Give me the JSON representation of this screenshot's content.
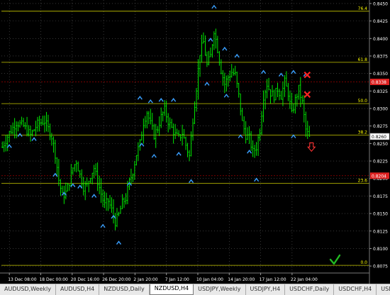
{
  "window": {
    "symbol": "NZDUSD",
    "timeframe": "H4"
  },
  "colors": {
    "background": "#000000",
    "candle": "#00ff00",
    "grid": "#5a5a5a",
    "fib_level": "#c8c800",
    "fib_label": "#ffff00",
    "resistance_line": "#a00000",
    "label_red_bg": "#dd2222",
    "fractal_arrow": "#3aa0ff",
    "signal_cross": "#ff2222",
    "signal_down_arrow": "#ff3333",
    "check_mark": "#22bb22",
    "axis_text": "#ffffff"
  },
  "icons": {
    "fractal": "chevron-up-icon",
    "signal": "cross-icon",
    "down": "down-arrow-icon",
    "check": "check-mark-icon"
  },
  "tabs": [
    {
      "label": "AUDUSD,Weekly",
      "active": false
    },
    {
      "label": "AUDUSD,H4",
      "active": false
    },
    {
      "label": "NZDUSD,Daily",
      "active": false
    },
    {
      "label": "NZDUSD,H4",
      "active": true
    },
    {
      "label": "USDJPY,Weekly",
      "active": false
    },
    {
      "label": "USDJPY,H4",
      "active": false
    },
    {
      "label": "USDCHF,Daily",
      "active": false
    },
    {
      "label": "USDCHF,H4",
      "active": false
    },
    {
      "label": "USDCAD,Week",
      "active": false
    }
  ],
  "tab_scroll": {
    "left": "◂",
    "right": "▸"
  },
  "chart_data": {
    "type": "candlestick",
    "symbol": "NZDUSD",
    "timeframe": "H4",
    "ylim": [
      0.8065,
      0.8455
    ],
    "y_ticks": [
      0.845,
      0.8425,
      0.84,
      0.8375,
      0.835,
      0.8325,
      0.83,
      0.8275,
      0.825,
      0.8225,
      0.82,
      0.8175,
      0.815,
      0.8125,
      0.81,
      0.8075
    ],
    "y_tick_labels": [
      "0.8450",
      "0.8425",
      "0.8400",
      "0.8375",
      "0.8350",
      "0.8325",
      "0.8300",
      "0.8275",
      "0.8250",
      "0.8225",
      "0.8200",
      "0.8175",
      "0.8150",
      "0.8125",
      "0.8100",
      "0.8075"
    ],
    "x_tick_labels": [
      "13 Dec 08:00",
      "18 Dec 00:00",
      "20 Dec 16:00",
      "26 Dec 20:00",
      "2 Jan 20:00",
      "7 Jan 12:00",
      "10 Jan 04:00",
      "14 Jan 20:00",
      "17 Jan 12:00",
      "22 Jan 04:00"
    ],
    "current_price": {
      "value": 0.826,
      "label": "0.8260"
    },
    "red_levels": [
      {
        "value": 0.8338,
        "label": "0.8338"
      },
      {
        "value": 0.8204,
        "label": "0.8204"
      }
    ],
    "fib_levels": [
      {
        "label": "76.4",
        "value": 0.8439
      },
      {
        "label": "61.8",
        "value": 0.8366
      },
      {
        "label": "50.0",
        "value": 0.8307
      },
      {
        "label": "38.2",
        "value": 0.8262
      },
      {
        "label": "23.6",
        "value": 0.8193
      },
      {
        "label": "0.0",
        "value": 0.8076
      }
    ],
    "close_path": [
      [
        0,
        0.8245
      ],
      [
        4,
        0.8265
      ],
      [
        8,
        0.828
      ],
      [
        12,
        0.8275
      ],
      [
        16,
        0.8262
      ],
      [
        20,
        0.8278
      ],
      [
        24,
        0.8282
      ],
      [
        28,
        0.826
      ],
      [
        30,
        0.8235
      ],
      [
        32,
        0.8198
      ],
      [
        34,
        0.8175
      ],
      [
        36,
        0.818
      ],
      [
        38,
        0.8195
      ],
      [
        40,
        0.8215
      ],
      [
        42,
        0.8225
      ],
      [
        44,
        0.8205
      ],
      [
        46,
        0.8188
      ],
      [
        48,
        0.819
      ],
      [
        50,
        0.8205
      ],
      [
        52,
        0.8215
      ],
      [
        54,
        0.8196
      ],
      [
        56,
        0.8178
      ],
      [
        58,
        0.8162
      ],
      [
        60,
        0.8168
      ],
      [
        62,
        0.8155
      ],
      [
        64,
        0.8138
      ],
      [
        66,
        0.8148
      ],
      [
        68,
        0.8165
      ],
      [
        70,
        0.8172
      ],
      [
        72,
        0.8195
      ],
      [
        74,
        0.821
      ],
      [
        76,
        0.8235
      ],
      [
        78,
        0.825
      ],
      [
        80,
        0.828
      ],
      [
        82,
        0.8295
      ],
      [
        84,
        0.8278
      ],
      [
        86,
        0.8262
      ],
      [
        88,
        0.8272
      ],
      [
        90,
        0.8288
      ],
      [
        92,
        0.8298
      ],
      [
        94,
        0.8282
      ],
      [
        96,
        0.8272
      ],
      [
        98,
        0.8262
      ],
      [
        100,
        0.8258
      ],
      [
        102,
        0.8265
      ],
      [
        104,
        0.8248
      ],
      [
        106,
        0.8232
      ],
      [
        108,
        0.8285
      ],
      [
        110,
        0.833
      ],
      [
        112,
        0.838
      ],
      [
        114,
        0.8395
      ],
      [
        116,
        0.8362
      ],
      [
        118,
        0.8375
      ],
      [
        120,
        0.8412
      ],
      [
        122,
        0.8385
      ],
      [
        124,
        0.8355
      ],
      [
        126,
        0.8335
      ],
      [
        128,
        0.8345
      ],
      [
        130,
        0.8352
      ],
      [
        132,
        0.8348
      ],
      [
        134,
        0.8318
      ],
      [
        136,
        0.828
      ],
      [
        138,
        0.8262
      ],
      [
        140,
        0.8258
      ],
      [
        142,
        0.8238
      ],
      [
        144,
        0.8245
      ],
      [
        146,
        0.827
      ],
      [
        148,
        0.8318
      ],
      [
        150,
        0.8335
      ],
      [
        152,
        0.8322
      ],
      [
        154,
        0.8318
      ],
      [
        156,
        0.8328
      ],
      [
        158,
        0.8318
      ],
      [
        160,
        0.8338
      ],
      [
        162,
        0.8322
      ],
      [
        164,
        0.8292
      ],
      [
        166,
        0.8312
      ],
      [
        168,
        0.8328
      ],
      [
        170,
        0.8308
      ],
      [
        172,
        0.827
      ],
      [
        174,
        0.8258
      ]
    ],
    "fractals_low": [
      [
        4,
        0.8246
      ],
      [
        10,
        0.8262
      ],
      [
        18,
        0.8256
      ],
      [
        30,
        0.8205
      ],
      [
        35,
        0.8178
      ],
      [
        40,
        0.819
      ],
      [
        44,
        0.8188
      ],
      [
        52,
        0.8175
      ],
      [
        57,
        0.8132
      ],
      [
        63,
        0.8145
      ],
      [
        66,
        0.8108
      ],
      [
        72,
        0.8192
      ],
      [
        79,
        0.8248
      ],
      [
        86,
        0.8232
      ],
      [
        100,
        0.8235
      ],
      [
        107,
        0.8196
      ],
      [
        116,
        0.8335
      ],
      [
        127,
        0.8318
      ],
      [
        135,
        0.826
      ],
      [
        140,
        0.8238
      ],
      [
        144,
        0.8198
      ],
      [
        165,
        0.826
      ]
    ],
    "fractals_high": [
      [
        78,
        0.8315
      ],
      [
        84,
        0.831
      ],
      [
        90,
        0.8312
      ],
      [
        97,
        0.8312
      ],
      [
        118,
        0.8398
      ],
      [
        120,
        0.8445
      ],
      [
        126,
        0.8385
      ],
      [
        133,
        0.8375
      ],
      [
        148,
        0.8352
      ],
      [
        158,
        0.8348
      ],
      [
        165,
        0.8352
      ],
      [
        172,
        0.8348
      ]
    ],
    "signals_sell": [
      {
        "x": 172,
        "y": 0.8348
      },
      {
        "x": 172,
        "y": 0.832
      }
    ],
    "signal_down": {
      "x": 174,
      "y": 0.8245
    }
  }
}
